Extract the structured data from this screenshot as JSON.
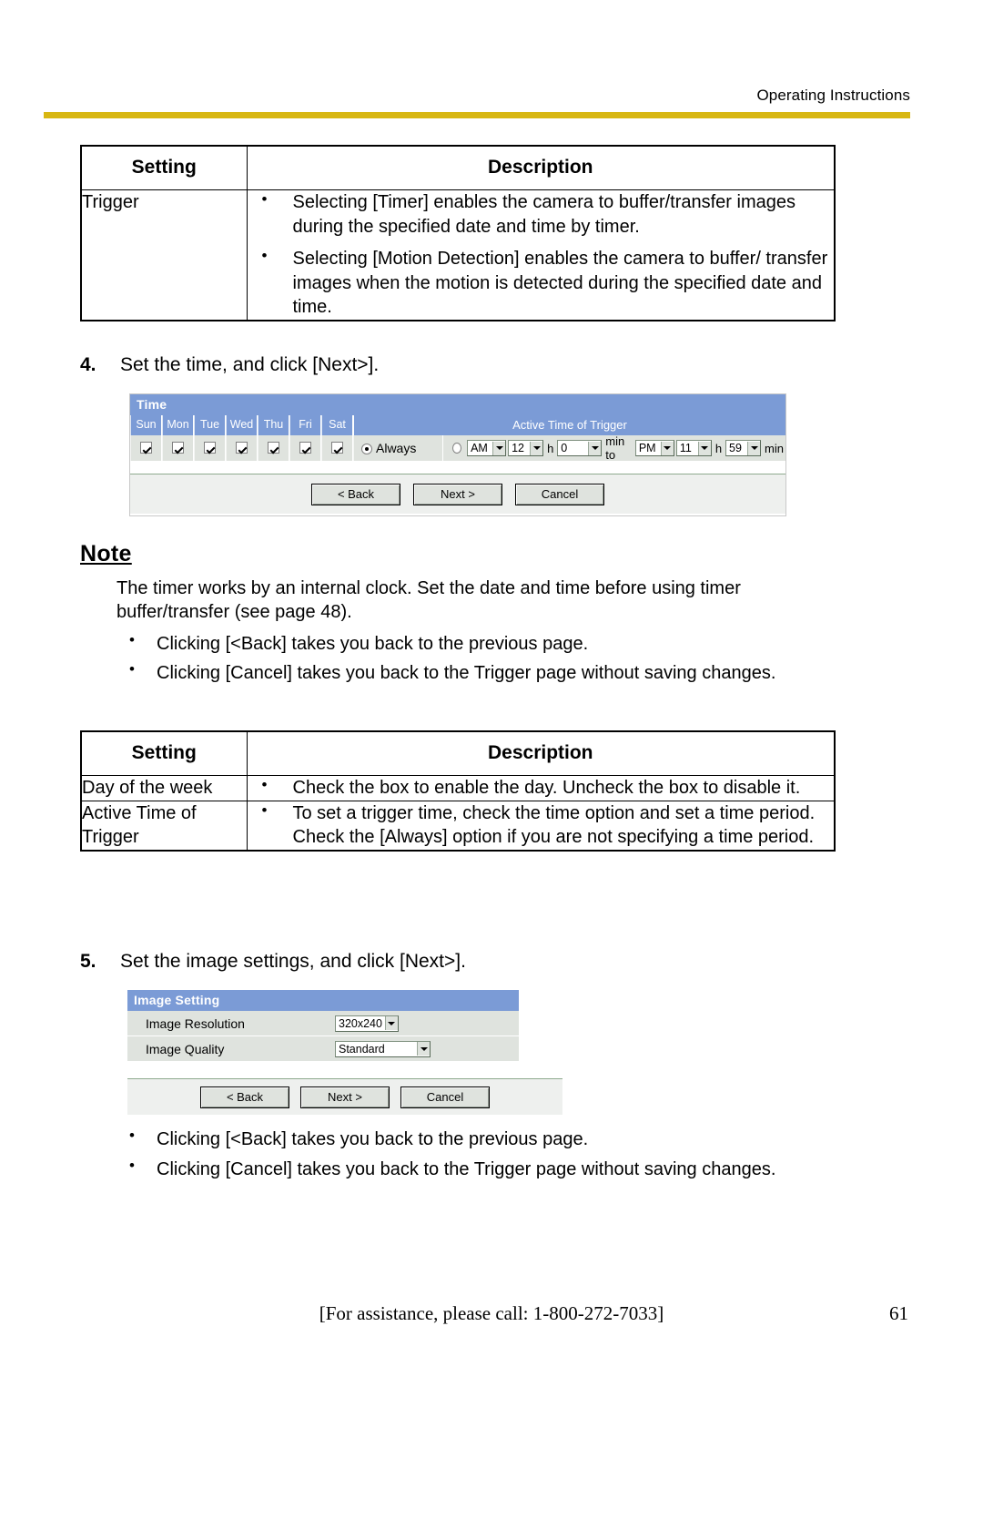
{
  "header": {
    "running_head": "Operating Instructions"
  },
  "table_trigger": {
    "headers": [
      "Setting",
      "Description"
    ],
    "rows": [
      {
        "setting": "Trigger",
        "bullets": [
          "Selecting [Timer] enables the camera to buffer/transfer images during the specified date and time by timer.",
          "Selecting [Motion Detection] enables the camera to buffer/ transfer images when the motion is detected during the specified date and time."
        ]
      }
    ]
  },
  "step4": {
    "number": "4.",
    "text": "Set the time, and click [Next>]."
  },
  "time_widget": {
    "title": "Time",
    "day_headers": [
      "Sun",
      "Mon",
      "Tue",
      "Wed",
      "Thu",
      "Fri",
      "Sat"
    ],
    "days_checked": [
      true,
      true,
      true,
      true,
      true,
      true,
      true
    ],
    "active_time_header": "Active Time of Trigger",
    "always_label": "Always",
    "always_selected": true,
    "range_selected": false,
    "start_ampm": "AM",
    "start_hour": "12",
    "start_min": "0",
    "end_ampm": "PM",
    "end_hour": "11",
    "end_min": "59",
    "unit_h": "h",
    "unit_min": "min",
    "unit_to": "min to",
    "buttons": [
      "< Back",
      "Next >",
      "Cancel"
    ]
  },
  "note": {
    "title": "Note",
    "paragraph": "The timer works by an internal clock. Set the date and time before using timer buffer/transfer (see page 48).",
    "bullets": [
      "Clicking [<Back] takes you back to the previous page.",
      "Clicking [Cancel] takes you back to the Trigger page without saving changes."
    ]
  },
  "table_time": {
    "headers": [
      "Setting",
      "Description"
    ],
    "rows": [
      {
        "setting": "Day of the week",
        "bullets": [
          "Check the box to enable the day. Uncheck the box to disable it."
        ]
      },
      {
        "setting": "Active Time of Trigger",
        "bullets": [
          "To set a trigger time, check the time option and set a time period. Check the [Always] option if you are not specifying a time period."
        ]
      }
    ]
  },
  "step5": {
    "number": "5.",
    "text": "Set the image settings, and click [Next>]."
  },
  "image_widget": {
    "title": "Image Setting",
    "rows": [
      {
        "label": "Image Resolution",
        "value": "320x240"
      },
      {
        "label": "Image Quality",
        "value": "Standard"
      }
    ],
    "buttons": [
      "< Back",
      "Next >",
      "Cancel"
    ]
  },
  "bottom_notes": {
    "bullets": [
      "Clicking [<Back] takes you back to the previous page.",
      "Clicking [Cancel] takes you back to the Trigger page without saving changes."
    ]
  },
  "footer": {
    "assistance": "[For assistance, please call: 1-800-272-7033]",
    "page_number": "61"
  },
  "colors": {
    "rule": "#d8b712",
    "widget_header": "#7b9bd6",
    "widget_field": "#dfe3de"
  }
}
